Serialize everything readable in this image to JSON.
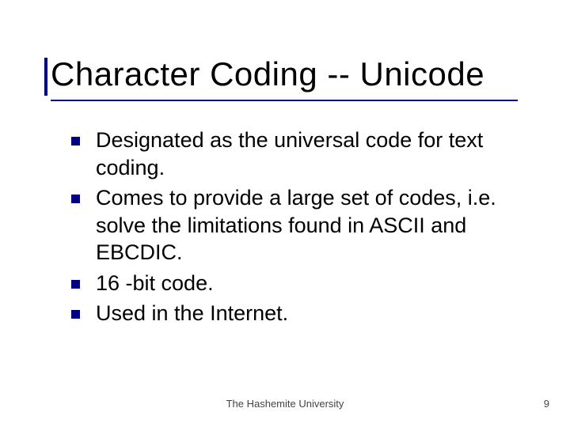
{
  "title": "Character Coding -- Unicode",
  "bullets": [
    "Designated as the universal code for text coding.",
    "Comes to provide a large set of codes, i.e. solve the limitations found in ASCII and EBCDIC.",
    "16 -bit code.",
    "Used in the Internet."
  ],
  "footer": {
    "center": "The Hashemite University",
    "pageNumber": "9"
  },
  "colors": {
    "accent": "#000080"
  }
}
